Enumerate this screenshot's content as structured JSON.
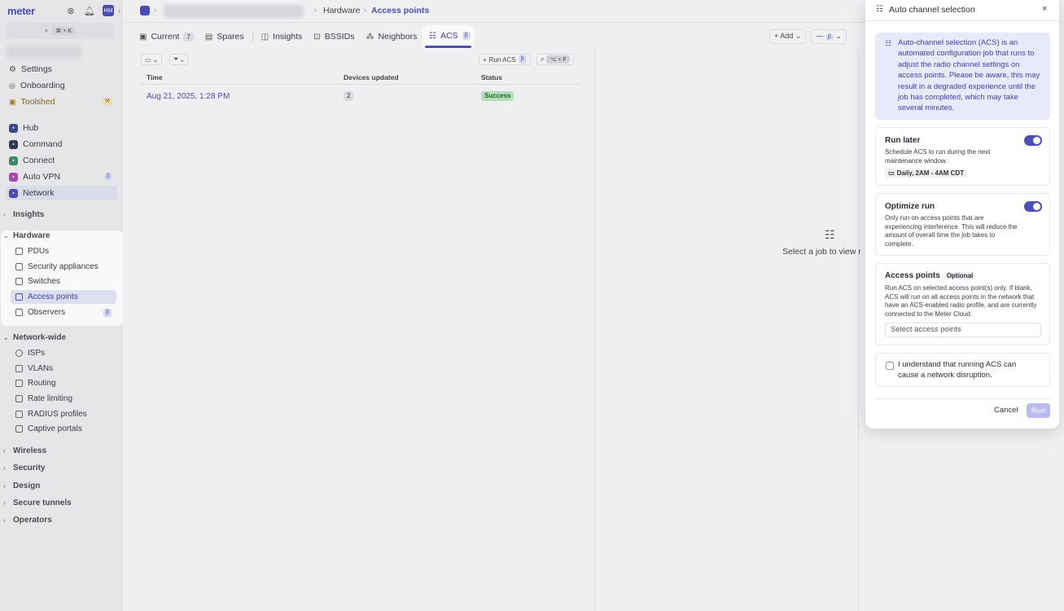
{
  "app": {
    "logo": "meter",
    "avatar_initials": "HM",
    "search_shortcut": "⌘ + K"
  },
  "sidebar": {
    "top_items": [
      {
        "label": "Settings",
        "icon": "gear-icon"
      },
      {
        "label": "Onboarding",
        "icon": "rocket-icon"
      },
      {
        "label": "Toolshed",
        "icon": "toolbox-icon",
        "badge": "⚒"
      }
    ],
    "products": [
      {
        "label": "Hub",
        "color": "#3b4b8f"
      },
      {
        "label": "Command",
        "color": "#2c3b54"
      },
      {
        "label": "Connect",
        "color": "#3c8f6a"
      },
      {
        "label": "Auto VPN",
        "color": "#b046b8",
        "badge": "β"
      },
      {
        "label": "Network",
        "color": "#4b4fb8",
        "active": true
      }
    ],
    "insights_label": "Insights",
    "hardware_label": "Hardware",
    "hardware_items": [
      {
        "label": "PDUs"
      },
      {
        "label": "Security appliances"
      },
      {
        "label": "Switches"
      },
      {
        "label": "Access points",
        "active": true
      },
      {
        "label": "Observers",
        "badge": "β"
      }
    ],
    "network_wide_label": "Network-wide",
    "network_wide_items": [
      {
        "label": "ISPs"
      },
      {
        "label": "VLANs"
      },
      {
        "label": "Routing"
      },
      {
        "label": "Rate limiting"
      },
      {
        "label": "RADIUS profiles"
      },
      {
        "label": "Captive portals"
      }
    ],
    "collapsed_sections": [
      "Wireless",
      "Security",
      "Design",
      "Secure tunnels",
      "Operators"
    ]
  },
  "breadcrumb": {
    "section": "Hardware",
    "current": "Access points"
  },
  "tabs": [
    {
      "label": "Current",
      "count": "7"
    },
    {
      "label": "Spares"
    },
    {
      "label": "Insights"
    },
    {
      "label": "BSSIDs"
    },
    {
      "label": "Neighbors",
      "badge": "?"
    }
  ],
  "active_tab": {
    "label": "ACS",
    "badge": "β"
  },
  "header_actions": {
    "add_label": "Add",
    "more_badge": "β"
  },
  "toolbar": {
    "run_acs_label": "Run ACS",
    "run_acs_badge": "β",
    "shortcut": "⌥ + F"
  },
  "table": {
    "columns": [
      "Time",
      "Devices updated",
      "Status"
    ],
    "rows": [
      {
        "time": "Aug 21, 2025, 1:28 PM",
        "devices": "2",
        "status": "Success"
      }
    ]
  },
  "empty_state": {
    "text": "Select a job to view r"
  },
  "dialog": {
    "title": "Auto channel selection",
    "info": "Auto-channel selection (ACS) is an automated configuration job that runs to adjust the radio channel settings on access points. Please be aware, this may result in a degraded experience until the job has completed, which may take several minutes.",
    "run_later": {
      "title": "Run later",
      "desc": "Schedule ACS to run during the next maintenance window.",
      "schedule": "Daily, 2AM - 4AM CDT",
      "enabled": true
    },
    "optimize": {
      "title": "Optimize run",
      "desc": "Only run on access points that are experiencing interference. This will reduce the amount of overall time the job takes to complete.",
      "enabled": true
    },
    "access_points": {
      "title": "Access points",
      "optional": "Optional",
      "desc": "Run ACS on selected access point(s) only. If blank, ACS will run on all access points in the network that have an ACS-enabled radio profile, and are currently connected to the Meter Cloud.",
      "placeholder": "Select access points"
    },
    "confirm_label": "I understand that running ACS can cause a network disruption.",
    "cancel_label": "Cancel",
    "run_label": "Run"
  },
  "colors": {
    "accent": "#4b4fb8",
    "success": "#b8e5bf"
  }
}
